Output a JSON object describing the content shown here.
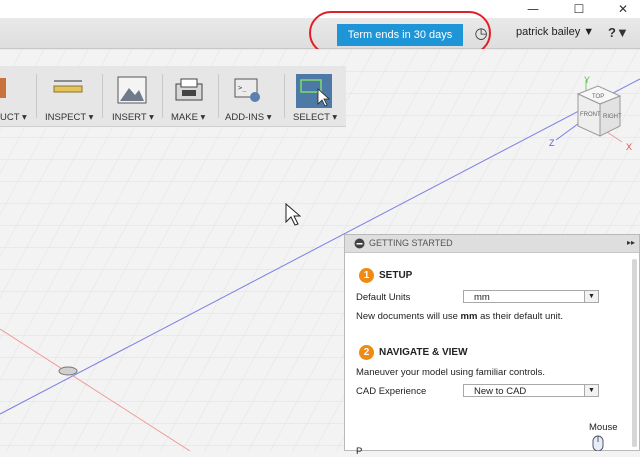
{
  "window_controls": {
    "minimize": "—",
    "maximize": "☐",
    "close": "✕"
  },
  "header": {
    "term_label": "Term ends in 30 days",
    "user_label": "patrick bailey ▼",
    "help_label": "?▼"
  },
  "toolbar": {
    "items": [
      {
        "label": "UCT ▾"
      },
      {
        "label": "INSPECT ▾"
      },
      {
        "label": "INSERT ▾"
      },
      {
        "label": "MAKE ▾"
      },
      {
        "label": "ADD-INS ▾"
      },
      {
        "label": "SELECT ▾"
      }
    ]
  },
  "viewcube": {
    "top": "TOP",
    "front": "FRONT",
    "right": "RIGHT",
    "axis_y": "Y",
    "axis_z": "Z",
    "axis_x": "X"
  },
  "panel": {
    "title": "GETTING STARTED",
    "setup": {
      "number": "1",
      "heading": "SETUP",
      "units_label": "Default Units",
      "units_value": "mm",
      "note_prefix": "New documents will use ",
      "note_value": "mm",
      "note_suffix": " as their default unit."
    },
    "navigate": {
      "number": "2",
      "heading": "NAVIGATE & VIEW",
      "desc": "Maneuver your model using familiar controls.",
      "cad_label": "CAD Experience",
      "cad_value": "New to CAD",
      "mouse_label": "Mouse",
      "partial": "P"
    }
  },
  "colors": {
    "accent": "#1d95d6",
    "highlight": "#e41e26",
    "step": "#ef8a12"
  }
}
